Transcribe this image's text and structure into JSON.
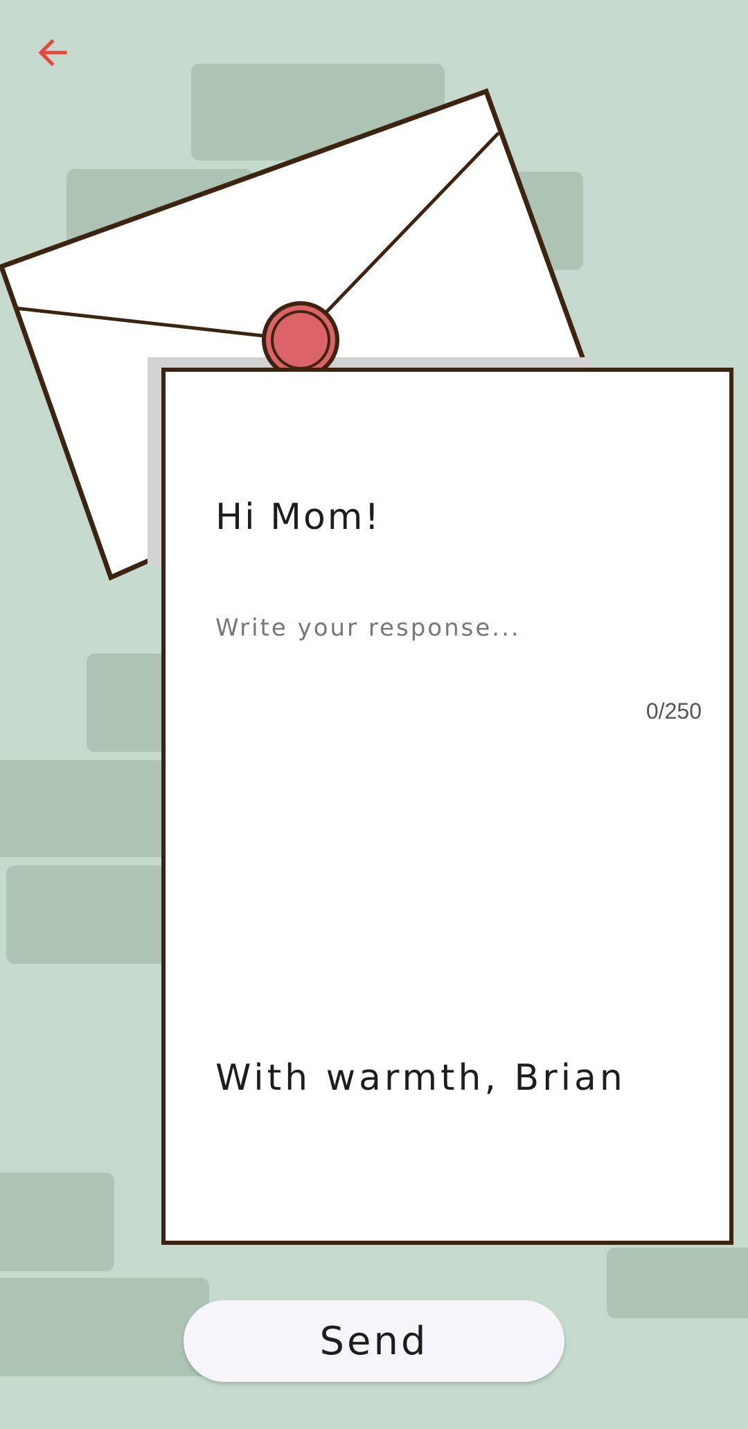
{
  "colors": {
    "background": "#c5d9cd",
    "brick": "#adc4b5",
    "outline": "#3d2410",
    "seal": "#dc6468",
    "back_arrow": "#e8463c",
    "button_bg": "#f5f5fa"
  },
  "header": {
    "back_icon": "arrow-left-icon"
  },
  "envelope": {
    "seal_icon": "wax-seal-icon"
  },
  "letter": {
    "greeting": "Hi Mom!",
    "response_placeholder": "Write your response...",
    "response_value": "",
    "char_count": "0/250",
    "signoff": "With warmth, Brian"
  },
  "actions": {
    "send_label": "Send"
  }
}
